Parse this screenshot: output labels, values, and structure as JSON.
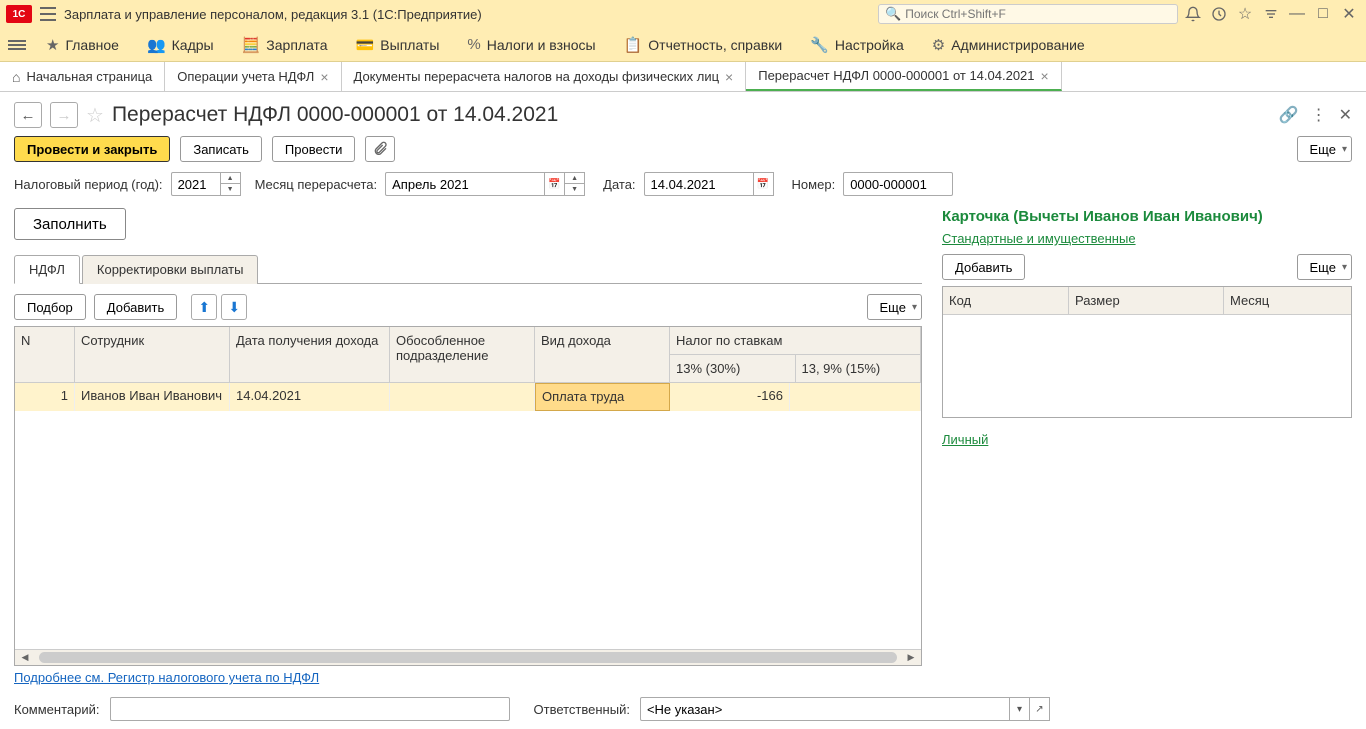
{
  "titlebar": {
    "app_title": "Зарплата и управление персоналом, редакция 3.1  (1С:Предприятие)",
    "search_placeholder": "Поиск Ctrl+Shift+F"
  },
  "mainmenu": [
    {
      "icon": "★",
      "label": "Главное"
    },
    {
      "icon": "👥",
      "label": "Кадры"
    },
    {
      "icon": "🧮",
      "label": "Зарплата"
    },
    {
      "icon": "💳",
      "label": "Выплаты"
    },
    {
      "icon": "%",
      "label": "Налоги и взносы"
    },
    {
      "icon": "📋",
      "label": "Отчетность, справки"
    },
    {
      "icon": "🔧",
      "label": "Настройка"
    },
    {
      "icon": "⚙",
      "label": "Администрирование"
    }
  ],
  "tabs": [
    {
      "label": "Начальная страница",
      "home": true,
      "closable": false
    },
    {
      "label": "Операции учета НДФЛ",
      "closable": true
    },
    {
      "label": "Документы перерасчета налогов на доходы физических лиц",
      "closable": true
    },
    {
      "label": "Перерасчет НДФЛ 0000-000001 от 14.04.2021",
      "closable": true,
      "active": true
    }
  ],
  "doc": {
    "title": "Перерасчет НДФЛ 0000-000001 от 14.04.2021",
    "buttons": {
      "post_close": "Провести и закрыть",
      "save": "Записать",
      "post": "Провести",
      "more": "Еще"
    }
  },
  "fields": {
    "period_label": "Налоговый период (год):",
    "period_value": "2021",
    "month_label": "Месяц перерасчета:",
    "month_value": "Апрель 2021",
    "date_label": "Дата:",
    "date_value": "14.04.2021",
    "number_label": "Номер:",
    "number_value": "0000-000001"
  },
  "fill_btn": "Заполнить",
  "subtabs": [
    {
      "label": "НДФЛ",
      "active": true
    },
    {
      "label": "Корректировки выплаты"
    }
  ],
  "tbl_toolbar": {
    "select": "Подбор",
    "add": "Добавить",
    "more": "Еще"
  },
  "table": {
    "headers": {
      "n": "N",
      "employee": "Сотрудник",
      "income_date": "Дата получения дохода",
      "department": "Обособленное подразделение",
      "income_type": "Вид дохода",
      "tax_rates": "Налог по ставкам",
      "rate13": "13% (30%)",
      "rate9": "13, 9% (15%)"
    },
    "rows": [
      {
        "n": "1",
        "employee": "Иванов Иван Иванович",
        "income_date": "14.04.2021",
        "department": "",
        "income_type": "Оплата труда",
        "tax13": "-166",
        "tax9": ""
      }
    ]
  },
  "card": {
    "title": "Карточка (Вычеты Иванов Иван Иванович)",
    "link1": "Стандартные и имущественные",
    "add": "Добавить",
    "more": "Еще",
    "headers": {
      "code": "Код",
      "size": "Размер",
      "month": "Месяц"
    },
    "link2": "Личный"
  },
  "bottom": {
    "link": "Подробнее см. Регистр налогового учета по НДФЛ",
    "comment_label": "Комментарий:",
    "responsible_label": "Ответственный:",
    "responsible_value": "<Не указан>"
  }
}
